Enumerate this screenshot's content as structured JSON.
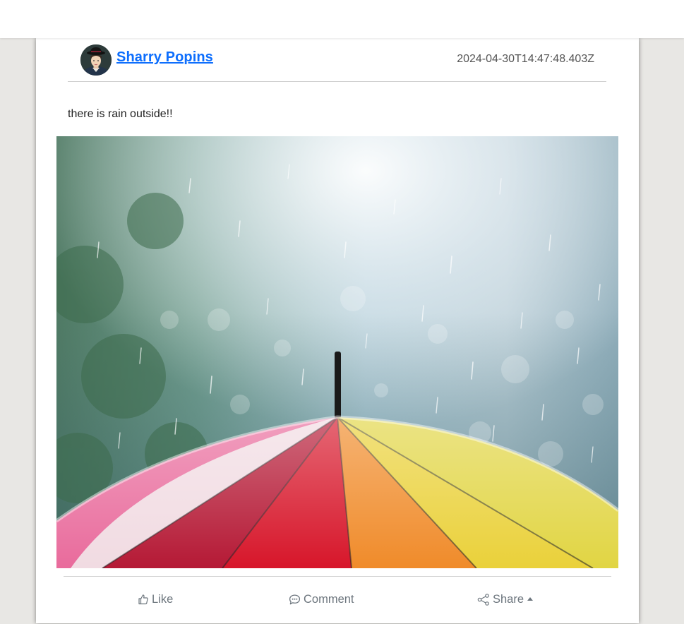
{
  "post": {
    "author": "Sharry Popins",
    "timestamp": "2024-04-30T14:47:48.403Z",
    "text": "there is rain outside!!",
    "image_subject": "rainbow-umbrella-in-rain"
  },
  "actions": {
    "like_label": "Like",
    "comment_label": "Comment",
    "share_label": "Share"
  },
  "icons": {
    "like": "thumbs-up-icon",
    "comment": "comment-icon",
    "share": "share-icon",
    "share_menu": "caret-up-icon"
  },
  "colors": {
    "link": "#0d6efd",
    "muted": "#6c757d",
    "page_background": "#e8e7e4",
    "card_background": "#ffffff"
  }
}
